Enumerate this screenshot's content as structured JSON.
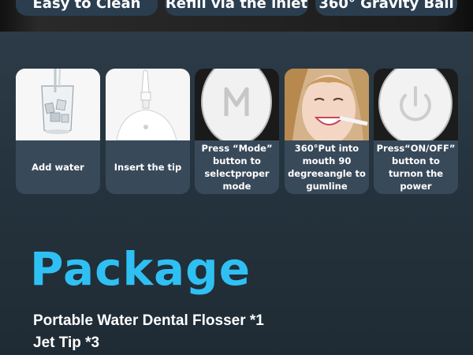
{
  "features": [
    {
      "label": "Easy to Clean"
    },
    {
      "label": "Refill via the inlet"
    },
    {
      "label": "360° Gravity Ball"
    }
  ],
  "steps": [
    {
      "caption": "Add water",
      "icon": "water-cup-icon"
    },
    {
      "caption": "Insert the tip",
      "icon": "nozzle-tip-icon"
    },
    {
      "caption": "Press “Mode” button to selectproper mode",
      "icon": "mode-button-icon"
    },
    {
      "caption": "360°Put into mouth 90 degreeangle to gumline",
      "icon": "smiling-woman-icon"
    },
    {
      "caption": "Press“ON/OFF” button to turnon the power",
      "icon": "power-button-icon"
    }
  ],
  "package": {
    "title": "Package",
    "items": [
      "Portable Water Dental Flosser *1",
      "Jet Tip *3"
    ]
  },
  "colors": {
    "accent": "#2fc0f3",
    "background": "#2e3d49",
    "card": "#38495a",
    "pill": "#2a3e4f"
  }
}
